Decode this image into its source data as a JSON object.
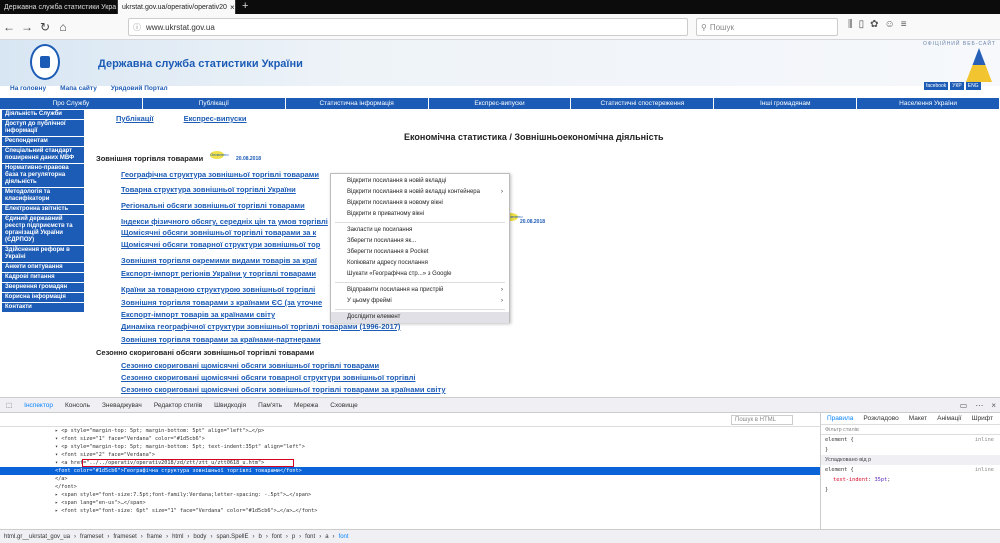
{
  "tabs": [
    {
      "label": "Державна служба статистики Укра"
    },
    {
      "label": "ukrstat.gov.ua/operativ/operativ20"
    }
  ],
  "url": "www.ukrstat.gov.ua",
  "search_placeholder": "Пошук",
  "site": {
    "official_label": "ОФІЦІЙНИЙ ВЕБ-САЙТ",
    "agency": "Державна служба статистики України",
    "top_links": [
      "На головну",
      "Мапа сайту",
      "Урядовий Портал"
    ],
    "social": [
      "facebook",
      "УКР",
      "ENG"
    ],
    "menu": [
      "Про Службу",
      "Публікації",
      "Статистична інформація",
      "Експрес-випуски",
      "Статистичні спостереження",
      "Інші громадянам",
      "Населення України"
    ],
    "sidebar": [
      "Діяльність Служби",
      "Доступ до публічної інформації",
      "Респондентам",
      "Спеціальний стандарт поширення даних МВФ",
      "Нормативно-правова база та регуляторна діяльність",
      "Методологія та класифікатори",
      "Електронна звітність",
      "Єдиний державний реєстр підприємств та організацій України (ЄДРПОУ)",
      "Здійснення реформ в Україні",
      "Анкети опитування",
      "Кадрові питання",
      "Звернення громадян",
      "Корисна інформація",
      "Контакти"
    ],
    "subtabs": [
      "Публікації",
      "Експрес-випуски"
    ],
    "page_heading": "Економічна статистика / Зовнішньоекономічна діяльність",
    "section1": "Зовнішня торгівля товарами",
    "new_badge": "Оновлено",
    "date1": "20.08.2018",
    "date2": "20.08.2018",
    "links1": [
      "Географічна структура зовнішньої торгівлі товарами",
      "Товарна структура зовнішньої торгівлі України",
      "Регіональні обсяги зовнішньої торгівлі товарами",
      "Індекси фізичного обсягу, середніх цін та умов торгівлі",
      "Щомісячні обсяги зовнішньої торгівлі товарами за к",
      "Щомісячні обсяги товарної структури зовнішньої тор",
      "Зовнішня торгівля окремими видами товарів за краї",
      "Експорт-імпорт регіонів України у торгівлі товарами",
      "Країни за товарною структурою зовнішньої торгівлі",
      "Зовнішня торгівля товарами з країнами ЄС (за уточне",
      "Експорт-імпорт товарів за країнами світу",
      "Динаміка географічної структури зовнішньої торгівлі товарами (1996-2017)",
      "Зовнішня торгівля товарами за країнами-партнерами"
    ],
    "section2": "Сезонно скориговані обсяги зовнішньої торгівлі товарами",
    "links2": [
      "Сезонно скориговані щомісячні обсяги зовнішньої торгівлі товарами",
      "Сезонно скориговані щомісячні обсяги товарної структури зовнішньої торгівлі",
      "Сезонно скориговані щомісячні обсяги зовнішньої торгівлі товарами за країнами світу"
    ]
  },
  "context_menu": [
    {
      "label": "Відкрити посилання в новій вкладці"
    },
    {
      "label": "Відкрити посилання в новій вкладці контейнера",
      "arrow": "›"
    },
    {
      "label": "Відкрити посилання в новому вікні"
    },
    {
      "label": "Відкрити в приватному вікні"
    },
    {
      "sep": true
    },
    {
      "label": "Закласти це посилання"
    },
    {
      "label": "Зберегти посилання як..."
    },
    {
      "label": "Зберегти посилання в Pocket"
    },
    {
      "label": "Копіювати адресу посилання"
    },
    {
      "label": "Шукати «Географічна стр...» з Google"
    },
    {
      "sep": true
    },
    {
      "label": "Відправити посилання на пристрій",
      "arrow": "›"
    },
    {
      "label": "У цьому фреймі",
      "arrow": "›"
    },
    {
      "sep": true
    },
    {
      "label": "Дослідити елемент",
      "hl": true
    }
  ],
  "devtools": {
    "tabs": [
      "Інспектор",
      "Консоль",
      "Зневаджувач",
      "Редактор стилів",
      "Швидкодія",
      "Пам'ять",
      "Мережа",
      "Сховище"
    ],
    "html_search": "Пошук в HTML",
    "markup": [
      "▸ <p style=\"margin-top: 5pt; margin-bottom: 5pt\" align=\"left\">…</p>",
      "▾ <font size=\"1\" face=\"Verdana\" color=\"#1d5cb6\">",
      "  ▾ <p style=\"margin-top: 5pt; margin-bottom: 5pt; text-indent:35pt\" align=\"left\">",
      "    ▾ <font size=\"2\" face=\"Verdana\">",
      "      ▾ <a href=\"../../operativ/operativ2018/zd/ztt/ztt_u/ztt0618_u.htm\">",
      "          <font color=\"#1d5cb6\">Географічна структура зовнішньої торгівлі товарами</font>",
      "        </a>",
      "      </font>",
      "    ▸ <span style=\"font-size:7.5pt;font-family:Verdana;letter-spacing: -.5pt\">…</span>",
      "    ▸ <span lang=\"en-us\">…</span>",
      "    ▸ <font style=\"font-size: 6pt\" size=\"1\" face=\"Verdana\" color=\"#1d5cb6\">…</a>…</font>"
    ],
    "rules_tabs": [
      "Правила",
      "Розкладово",
      "Макет",
      "Анімації",
      "Шрифт"
    ],
    "filter": "Фільтр стилів",
    "rule1_sel": "element {",
    "rule1_src": "inline",
    "rule1_end": "}",
    "inherited": "Успадковано від p",
    "rule2_sel": "element {",
    "rule2_prop": "text-indent",
    "rule2_val": "35pt",
    "rule2_src": "inline",
    "rule2_end": "}"
  },
  "breadcrumb": [
    "html.gr__ukrstat_gov_ua",
    "frameset",
    "frameset",
    "frame",
    "html",
    "body",
    "span.SpellE",
    "b",
    "font",
    "p",
    "font",
    "a",
    "font"
  ]
}
